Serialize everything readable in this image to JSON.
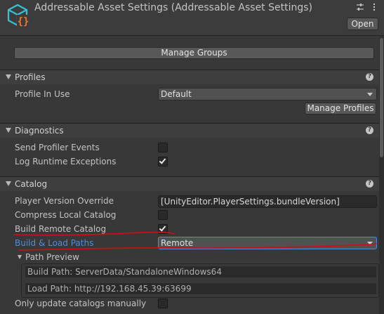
{
  "header": {
    "title": "Addressable Asset Settings (Addressable Asset Settings)",
    "open_label": "Open",
    "icons": [
      "addressables-asset-icon",
      "adjust-icon",
      "more-options-icon"
    ]
  },
  "manage_groups_label": "Manage Groups",
  "sections": {
    "profiles": {
      "title": "Profiles",
      "profile_in_use_label": "Profile In Use",
      "profile_in_use_value": "Default",
      "manage_profiles_label": "Manage Profiles"
    },
    "diagnostics": {
      "title": "Diagnostics",
      "send_profiler_events_label": "Send Profiler Events",
      "send_profiler_events_checked": false,
      "log_runtime_exceptions_label": "Log Runtime Exceptions",
      "log_runtime_exceptions_checked": true
    },
    "catalog": {
      "title": "Catalog",
      "player_version_override_label": "Player Version Override",
      "player_version_override_value": "[UnityEditor.PlayerSettings.bundleVersion]",
      "compress_local_catalog_label": "Compress Local Catalog",
      "compress_local_catalog_checked": false,
      "build_remote_catalog_label": "Build Remote Catalog",
      "build_remote_catalog_checked": true,
      "build_load_paths_label": "Build & Load Paths",
      "build_load_paths_value": "Remote",
      "path_preview_label": "Path Preview",
      "build_path": "Build Path: ServerData/StandaloneWindows64",
      "load_path": "Load Path: http://192.168.45.39:63699",
      "only_update_manually_label": "Only update catalogs manually",
      "only_update_manually_checked": false
    }
  },
  "colors": {
    "background": "#383838",
    "link": "#4f8dd8",
    "annotation": "#c8101a",
    "icon_cyan": "#37c1d2",
    "icon_orange": "#f07a2a"
  }
}
